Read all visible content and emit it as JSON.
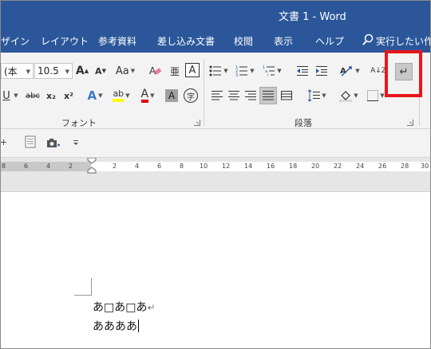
{
  "window": {
    "title": "文書 1  -  Word",
    "title_bar_color": "#2b579a"
  },
  "tabs": [
    {
      "label": "ザイン"
    },
    {
      "label": "レイアウト"
    },
    {
      "label": "参考資料"
    },
    {
      "label": "差し込み文書"
    },
    {
      "label": "校閲"
    },
    {
      "label": "表示"
    },
    {
      "label": "ヘルプ"
    }
  ],
  "tell_me": {
    "label": "実行したい作",
    "icon": "lightbulb-search-icon"
  },
  "font_group": {
    "label": "フォント",
    "font_name": "(本",
    "font_size": "10.5",
    "grow_label": "A",
    "shrink_label": "A",
    "case_label": "Aa",
    "furigana_label": "亜",
    "border_char_label": "A",
    "underline_label": "U",
    "strike_label": "abc",
    "sub_label": "x₂",
    "sup_label": "x²",
    "effects_label": "A",
    "highlight_label": "ab",
    "font_color_label": "A",
    "shade_label": "A",
    "enclose_label": "字",
    "font_color": "#e00000",
    "highlight_color": "#ffff00"
  },
  "paragraph_group": {
    "label": "段落",
    "sort_label": "A↓Z",
    "show_marks_label": "↵"
  },
  "ruler": {
    "left_ticks": [
      "8",
      "6",
      "4",
      "2"
    ],
    "right_ticks": [
      "2",
      "4",
      "6",
      "8",
      "10",
      "12",
      "14",
      "16",
      "18",
      "20",
      "22",
      "24",
      "26",
      "28",
      "30"
    ]
  },
  "document": {
    "lines": [
      {
        "text": "あ□あ□あ",
        "mark": "↵"
      },
      {
        "text": "ああああ",
        "mark": ""
      }
    ]
  },
  "highlight_box_color": "#e8161b"
}
